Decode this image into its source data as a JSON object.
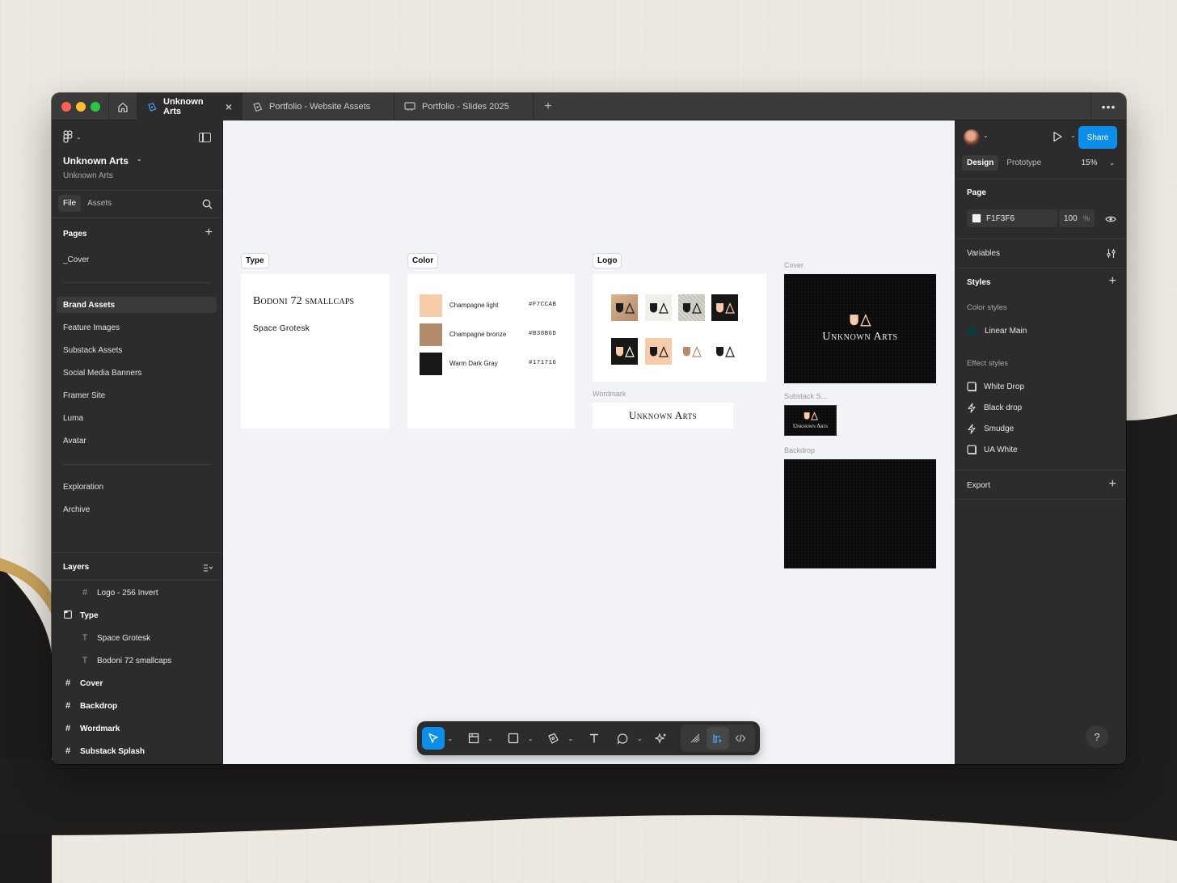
{
  "tabs": [
    {
      "label": "Unknown Arts",
      "active": true
    },
    {
      "label": "Portfolio - Website Assets",
      "active": false
    },
    {
      "label": "Portfolio - Slides 2025",
      "active": false
    }
  ],
  "file": {
    "name": "Unknown Arts",
    "team": "Unknown Arts"
  },
  "left_tabs": {
    "file": "File",
    "assets": "Assets"
  },
  "pages": {
    "heading": "Pages",
    "items": [
      "_Cover",
      "Brand Assets",
      "Feature Images",
      "Substack Assets",
      "Social Media Banners",
      "Framer Site",
      "Luma",
      "Avatar",
      "Exploration",
      "Archive"
    ],
    "selected": "Brand Assets"
  },
  "layers": {
    "heading": "Layers",
    "items": [
      {
        "label": "Logo - 256 Invert",
        "icon": "frame-icon",
        "indent": 1,
        "bold": false
      },
      {
        "label": "Type",
        "icon": "section-icon",
        "indent": 0,
        "bold": true
      },
      {
        "label": "Space Grotesk",
        "icon": "text-icon",
        "indent": 1,
        "bold": false
      },
      {
        "label": "Bodoni 72 smallcaps",
        "icon": "text-icon",
        "indent": 1,
        "bold": false
      },
      {
        "label": "Cover",
        "icon": "frame-icon",
        "indent": 0,
        "bold": true
      },
      {
        "label": "Backdrop",
        "icon": "frame-icon",
        "indent": 0,
        "bold": true
      },
      {
        "label": "Wordmark",
        "icon": "frame-icon",
        "indent": 0,
        "bold": true
      },
      {
        "label": "Substack Splash",
        "icon": "frame-icon",
        "indent": 0,
        "bold": true
      }
    ]
  },
  "canvas": {
    "type_label": "Type",
    "type_samples": [
      "Bodoni 72 smallcaps",
      "Space Grotesk"
    ],
    "color_label": "Color",
    "colors": [
      {
        "name": "Champagne light",
        "hex": "#F7CCAB"
      },
      {
        "name": "Champagne bronze",
        "hex": "#B38B6D"
      },
      {
        "name": "Warm Dark Gray",
        "hex": "#171716"
      }
    ],
    "logo_label": "Logo",
    "wordmark_label": "Wordmark",
    "wordmark_text": "Unknown Arts",
    "cover_label": "Cover",
    "cover_text": "Unknown Arts",
    "substack_label": "Substack S...",
    "substack_text": "Unknown Arts",
    "backdrop_label": "Backdrop"
  },
  "right": {
    "share": "Share",
    "tabs": {
      "design": "Design",
      "prototype": "Prototype"
    },
    "zoom": "15%",
    "page_heading": "Page",
    "page_color": "F1F3F6",
    "page_opacity": "100",
    "page_opacity_unit": "%",
    "variables": "Variables",
    "styles": "Styles",
    "color_styles_heading": "Color styles",
    "color_styles": [
      {
        "label": "Linear Main",
        "color": "#0f3a3a"
      }
    ],
    "effect_styles_heading": "Effect styles",
    "effect_styles": [
      {
        "label": "White Drop",
        "icon": "drop-shadow-icon"
      },
      {
        "label": "Black drop",
        "icon": "effect-bolt-icon"
      },
      {
        "label": "Smudge",
        "icon": "effect-bolt-icon"
      },
      {
        "label": "UA White",
        "icon": "drop-shadow-icon"
      }
    ],
    "export": "Export",
    "help": "?"
  },
  "colors": {
    "accent": "#0d8ee9",
    "champagne_light": "#f7ccab",
    "champagne_bronze": "#b38b6d",
    "warm_dark_gray": "#171716"
  }
}
